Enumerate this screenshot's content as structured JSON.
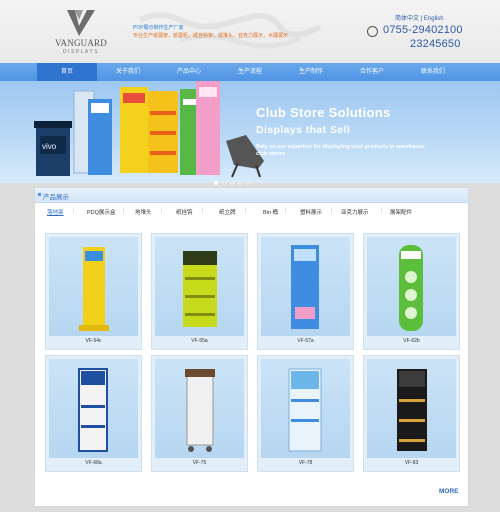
{
  "header": {
    "brand": "VANGUARD",
    "brand_sub": "DISPLAYS",
    "tagline_1": "POP展示制作生产厂家",
    "tagline_2": "专业生产纸展架，纸展柜，纸挂钩架，纸堆头，亚克力展示，木展展示",
    "lang_cn": "简体中文",
    "lang_sep": "|",
    "lang_en": "English",
    "phone_1": "0755-29402100",
    "phone_2": "23245650"
  },
  "nav": {
    "items": [
      {
        "label": "首页",
        "active": true
      },
      {
        "label": "关于我们",
        "active": false
      },
      {
        "label": "产品中心",
        "active": false
      },
      {
        "label": "生产流程",
        "active": false
      },
      {
        "label": "生产制作",
        "active": false
      },
      {
        "label": "合作客户",
        "active": false
      },
      {
        "label": "联系我们",
        "active": false
      }
    ]
  },
  "banner": {
    "title_1": "Club Store Solutions",
    "title_2": "Displays that Sell",
    "description": "Rely on our expertise for displaying your products in warehouse club stores",
    "kiosk_brand": "vivo",
    "slides": 5,
    "current_slide": 1
  },
  "products": {
    "title": "产品展示",
    "categories": [
      "落地架",
      "PDQ展示盒",
      "地堆头",
      "纸挂钩",
      "纸立牌",
      "Bin 桶",
      "塑料展示",
      "亚克力展示",
      "展架配件"
    ],
    "active_category": 0,
    "items": [
      {
        "code": "VF-54c"
      },
      {
        "code": "VF-55a"
      },
      {
        "code": "VF-57a"
      },
      {
        "code": "VF-62b"
      },
      {
        "code": "VF-68a"
      },
      {
        "code": "VF-75"
      },
      {
        "code": "VF-78"
      },
      {
        "code": "VF-83"
      }
    ],
    "more_label": "MORE"
  }
}
